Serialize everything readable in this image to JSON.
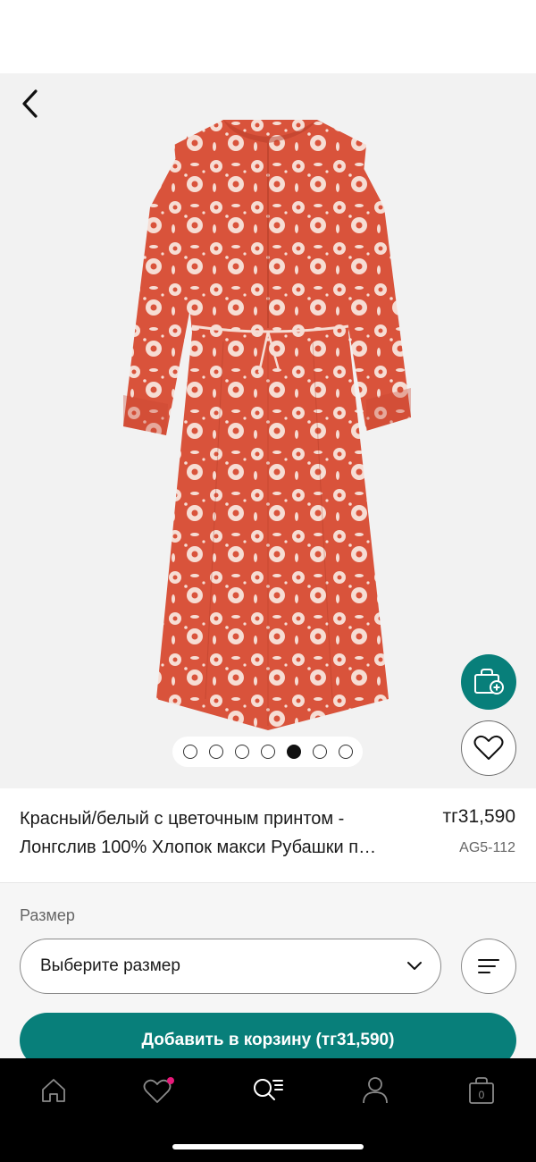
{
  "colors": {
    "accent": "#087f7a",
    "dress_red": "#d9533b",
    "dress_light": "#f6ddd4",
    "wishlist_dot": "#e8197a"
  },
  "gallery": {
    "back_icon": "chevron-left-icon",
    "image_count": 7,
    "active_image_index": 4
  },
  "product": {
    "title_line1": "Красный/белый с цветочным принтом -",
    "title_line2": "Лонгслив 100% Хлопок макси Рубашки п…",
    "price": "тг31,590",
    "sku": "AG5-112"
  },
  "size": {
    "label": "Размер",
    "placeholder": "Выберите размер"
  },
  "cart": {
    "button_label": "Добавить в корзину (тг31,590)"
  },
  "tabbar": {
    "bag_count": "0",
    "items": [
      "home-icon",
      "wishlist-icon",
      "search-menu-icon",
      "account-icon",
      "bag-icon"
    ]
  }
}
